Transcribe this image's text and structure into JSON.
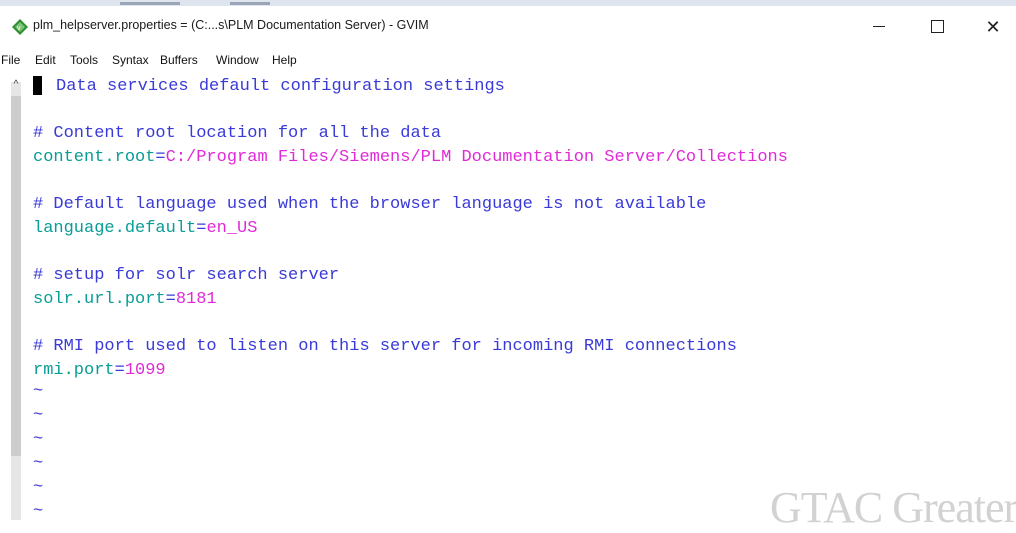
{
  "window": {
    "title": "plm_helpserver.properties = (C:...s\\PLM Documentation Server) - GVIM",
    "minimize_glyph": "",
    "maximize_glyph": "",
    "close_glyph": "✕"
  },
  "menubar": {
    "items": [
      "File",
      "Edit",
      "Tools",
      "Syntax",
      "Buffers",
      "Window",
      "Help"
    ]
  },
  "editor": {
    "header_comment": "Data services default configuration settings",
    "sections": [
      {
        "comment": "# Content root location for all the data",
        "key": "content.root",
        "eq": "=",
        "value": "C:/Program Files/Siemens/PLM Documentation Server/Collections"
      },
      {
        "comment": "# Default language used when the browser language is not available",
        "key": "language.default",
        "eq": "=",
        "value": "en_US"
      },
      {
        "comment": "# setup for solr search server",
        "key": "solr.url.port",
        "eq": "=",
        "value": "8181"
      },
      {
        "comment": "# RMI port used to listen on this server for incoming RMI connections",
        "key": "rmi.port",
        "eq": "=",
        "value": "1099"
      }
    ],
    "tilde": "~"
  },
  "watermark": {
    "text": "GTAC Greater"
  },
  "colors": {
    "comment": "#3a3ad8",
    "key": "#0a9d96",
    "value": "#e02ad8"
  },
  "icons": [
    "gvim-app-icon",
    "minimize-icon",
    "maximize-icon",
    "close-icon",
    "scroll-up-arrow-icon"
  ]
}
